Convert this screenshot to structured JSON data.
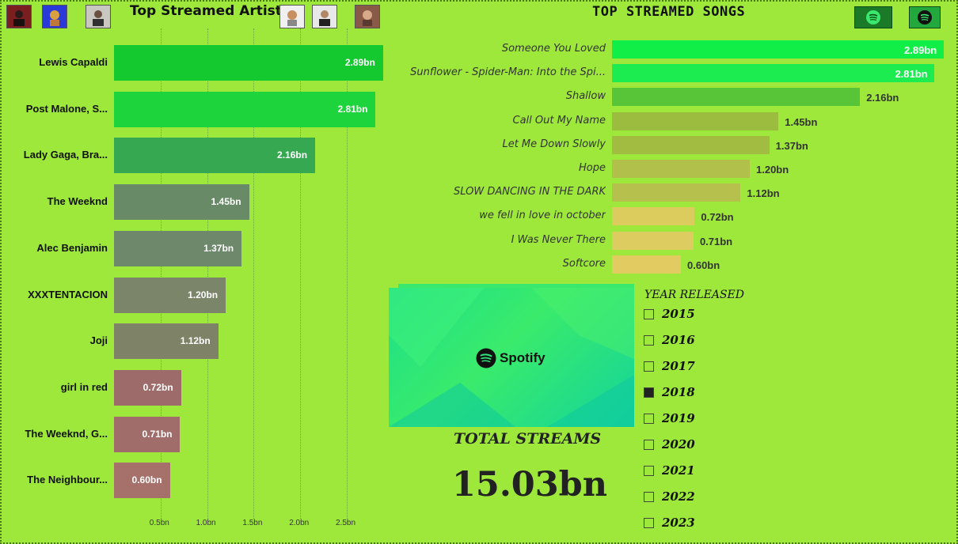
{
  "left_chart": {
    "title": "Top Streamed Artistes",
    "artists": [
      {
        "label": "Lewis Capaldi",
        "value": 2.89,
        "value_label": "2.89bn",
        "color": "#14c830"
      },
      {
        "label": "Post Malone, S...",
        "value": 2.81,
        "value_label": "2.81bn",
        "color": "#1ed43c"
      },
      {
        "label": "Lady Gaga, Bra...",
        "value": 2.16,
        "value_label": "2.16bn",
        "color": "#36a852"
      },
      {
        "label": "The Weeknd",
        "value": 1.45,
        "value_label": "1.45bn",
        "color": "#698a66"
      },
      {
        "label": "Alec Benjamin",
        "value": 1.37,
        "value_label": "1.37bn",
        "color": "#6d886a"
      },
      {
        "label": "XXXTENTACION",
        "value": 1.2,
        "value_label": "1.20bn",
        "color": "#7a8569"
      },
      {
        "label": "Joji",
        "value": 1.12,
        "value_label": "1.12bn",
        "color": "#7e8368"
      },
      {
        "label": "girl in red",
        "value": 0.72,
        "value_label": "0.72bn",
        "color": "#9d6b6a"
      },
      {
        "label": "The Weeknd, G...",
        "value": 0.71,
        "value_label": "0.71bn",
        "color": "#a06d6b"
      },
      {
        "label": "The Neighbour...",
        "value": 0.6,
        "value_label": "0.60bn",
        "color": "#a6706b"
      }
    ],
    "ticks": [
      "0.5bn",
      "1.0bn",
      "1.5bn",
      "2.0bn",
      "2.5bn"
    ],
    "tick_values": [
      0.5,
      1.0,
      1.5,
      2.0,
      2.5
    ]
  },
  "right_chart": {
    "title": "TOP STREAMED SONGS",
    "songs": [
      {
        "label": "Someone You Loved",
        "value": 2.89,
        "value_label": "2.89bn",
        "color": "#12ee48"
      },
      {
        "label": "Sunflower - Spider-Man: Into the Spi...",
        "value": 2.81,
        "value_label": "2.81bn",
        "color": "#1cec50"
      },
      {
        "label": "Shallow",
        "value": 2.16,
        "value_label": "2.16bn",
        "color": "#58c438"
      },
      {
        "label": "Call Out My Name",
        "value": 1.45,
        "value_label": "1.45bn",
        "color": "#9cbc40"
      },
      {
        "label": "Let Me Down Slowly",
        "value": 1.37,
        "value_label": "1.37bn",
        "color": "#a2bc42"
      },
      {
        "label": "Hope",
        "value": 1.2,
        "value_label": "1.20bn",
        "color": "#b0c04a"
      },
      {
        "label": "SLOW DANCING IN THE DARK",
        "value": 1.12,
        "value_label": "1.12bn",
        "color": "#b6c04c"
      },
      {
        "label": "we fell in love in october",
        "value": 0.72,
        "value_label": "0.72bn",
        "color": "#dccc5e"
      },
      {
        "label": "I Was Never There",
        "value": 0.71,
        "value_label": "0.71bn",
        "color": "#ddcc60"
      },
      {
        "label": "Softcore",
        "value": 0.6,
        "value_label": "0.60bn",
        "color": "#e2cc62"
      }
    ]
  },
  "spotify": {
    "logo_text": "Spotify"
  },
  "total": {
    "title": "TOTAL STREAMS",
    "value": "15.03bn"
  },
  "year_filter": {
    "title": "YEAR RELEASED",
    "years": [
      {
        "label": "2015",
        "checked": false
      },
      {
        "label": "2016",
        "checked": false
      },
      {
        "label": "2017",
        "checked": false
      },
      {
        "label": "2018",
        "checked": true
      },
      {
        "label": "2019",
        "checked": false
      },
      {
        "label": "2020",
        "checked": false
      },
      {
        "label": "2021",
        "checked": false
      },
      {
        "label": "2022",
        "checked": false
      },
      {
        "label": "2023",
        "checked": false
      }
    ]
  },
  "icons": {
    "artist_thumbnails": [
      "artist-photo-icon",
      "artist-photo-icon",
      "artist-photo-icon",
      "artist-photo-icon",
      "artist-photo-icon",
      "artist-photo-icon"
    ],
    "spotify_buttons": [
      "spotify-icon",
      "spotify-icon"
    ]
  },
  "colors": {
    "background": "#9de83a",
    "accent": "#1ed760"
  }
}
